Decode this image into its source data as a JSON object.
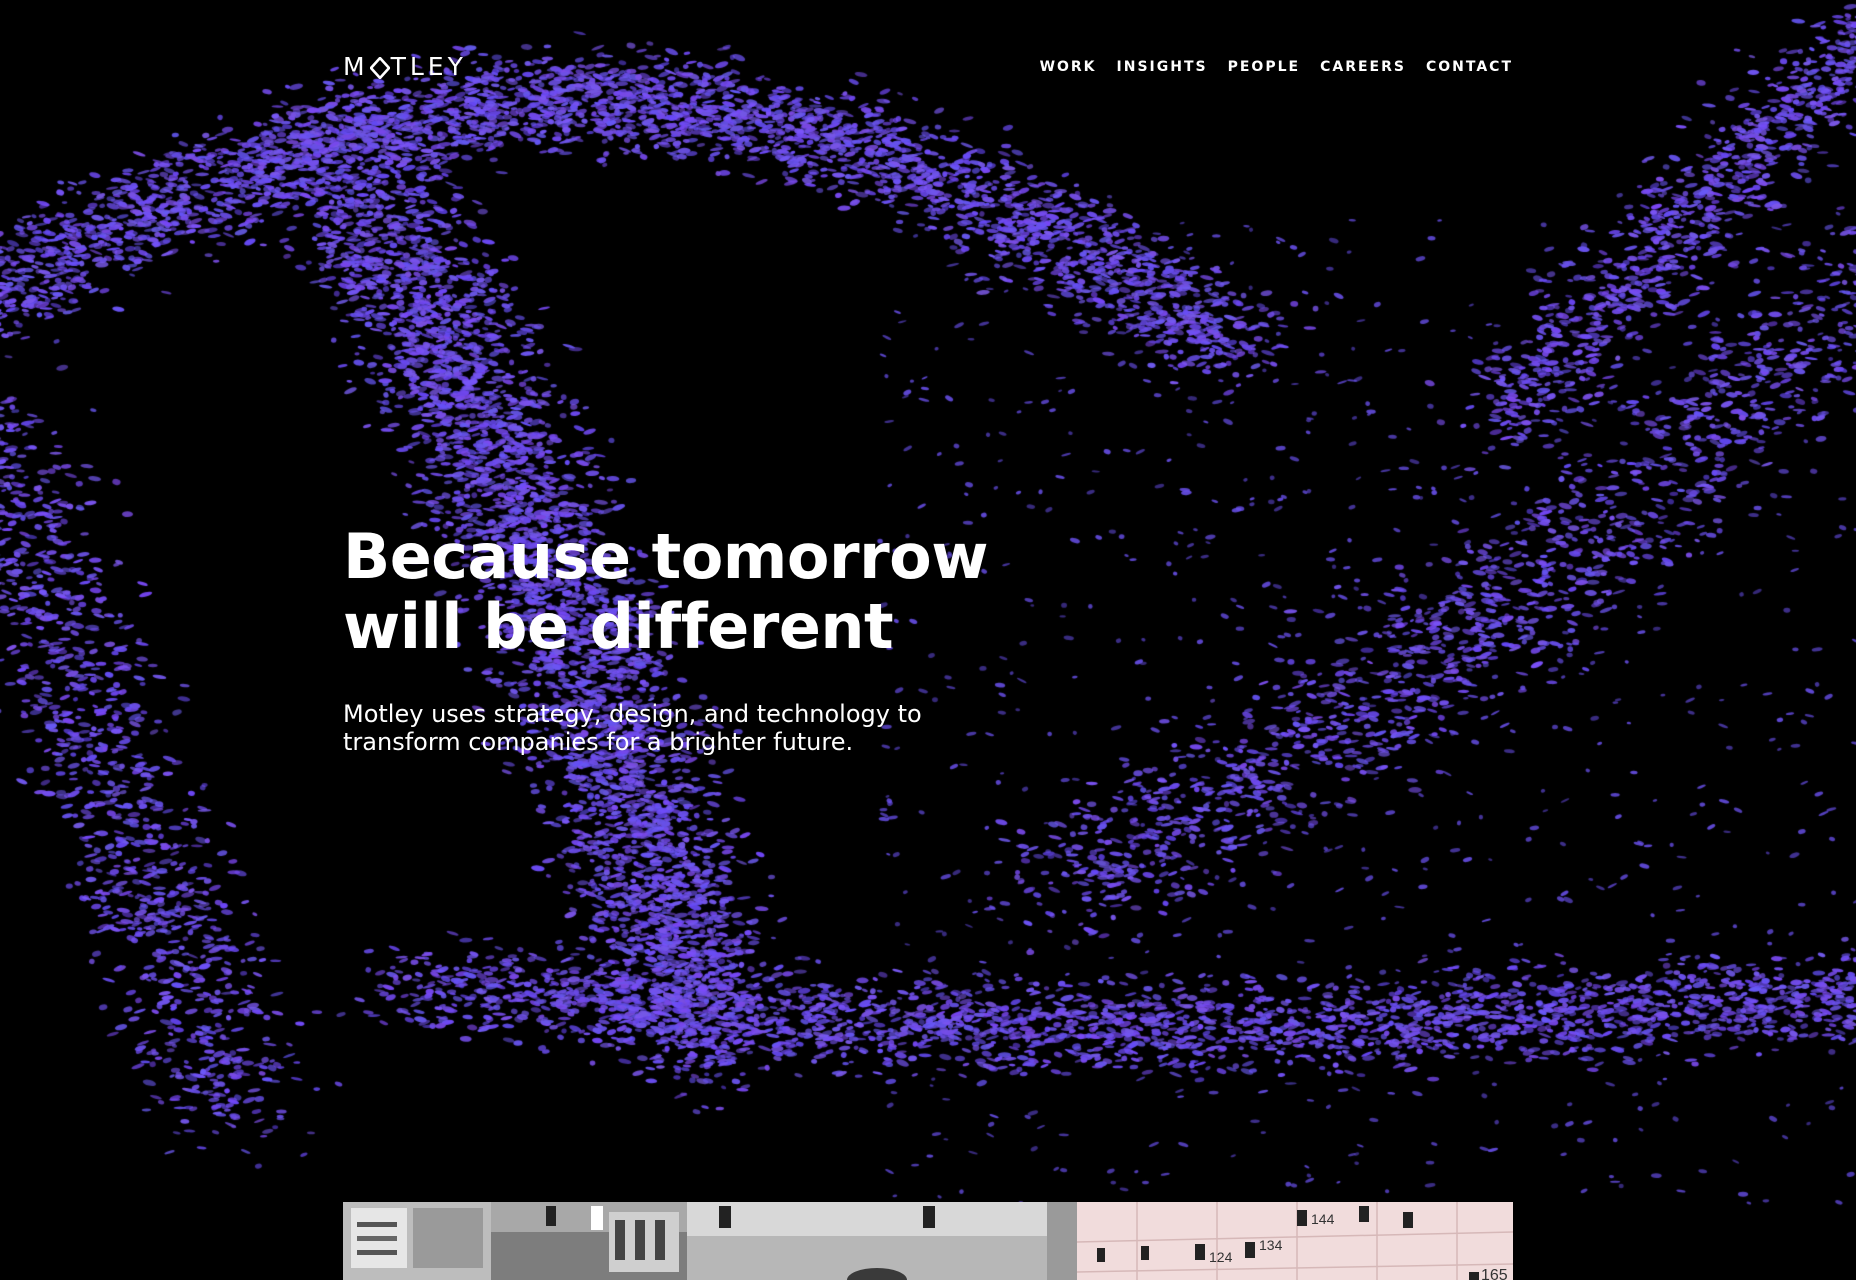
{
  "header": {
    "logo": "MOTLEY",
    "nav": [
      {
        "label": "WORK"
      },
      {
        "label": "INSIGHTS"
      },
      {
        "label": "PEOPLE"
      },
      {
        "label": "CAREERS"
      },
      {
        "label": "CONTACT"
      }
    ]
  },
  "hero": {
    "headline": "Because tomorrow will be different",
    "subtext": "Motley uses strategy, design, and technology to transform companies for a brighter future."
  },
  "preview": {
    "locker_numbers": [
      "144",
      "134",
      "124",
      "165"
    ]
  },
  "colors": {
    "background": "#000000",
    "particle": "#6a4ee6",
    "text": "#ffffff"
  }
}
